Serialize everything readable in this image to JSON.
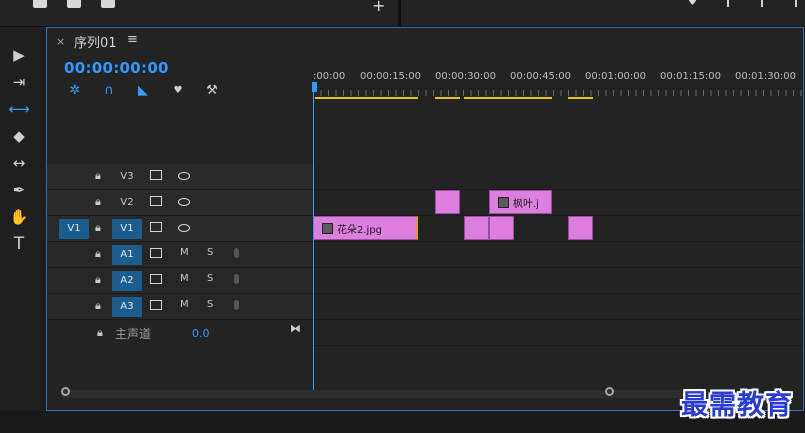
{
  "sequence": {
    "tab_title": "序列01",
    "menu_icon": "hamburger-menu-icon",
    "close_glyph": "×"
  },
  "timecode": "00:00:00:00",
  "ruler": {
    "labels": [
      ":00:00",
      "00:00:15:00",
      "00:00:30:00",
      "00:00:45:00",
      "00:01:00:00",
      "00:01:15:00",
      "00:01:30:00"
    ]
  },
  "tools": [
    "selection-tool-icon",
    "track-select-tool-icon",
    "ripple-edit-tool-icon",
    "razor-tool-icon",
    "slip-tool-icon",
    "pen-tool-icon",
    "hand-tool-icon",
    "type-tool-icon"
  ],
  "video_tracks": [
    {
      "name": "V3",
      "targeted": false
    },
    {
      "name": "V2",
      "targeted": false
    },
    {
      "name": "V1",
      "targeted": true,
      "source": "V1"
    }
  ],
  "audio_tracks": [
    {
      "name": "A1",
      "mute": "M",
      "solo": "S"
    },
    {
      "name": "A2",
      "mute": "M",
      "solo": "S"
    },
    {
      "name": "A3",
      "mute": "M",
      "solo": "S"
    }
  ],
  "master": {
    "label": "主声道",
    "value": "0.0"
  },
  "clips": {
    "v1_main": "花朵2.jpg",
    "v2_named": "枫叶.j"
  },
  "watermark": "最需教育",
  "colors": {
    "accent": "#2f9bff",
    "clip": "#de7fe0",
    "workarea": "#e6c21a",
    "track_target": "#1c5d8f"
  }
}
